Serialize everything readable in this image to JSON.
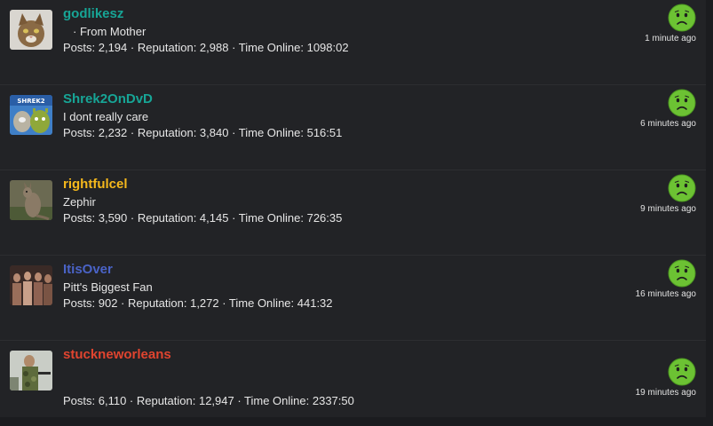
{
  "users": [
    {
      "name": "godlikesz",
      "name_color": "#17a596",
      "status": "· From Mother",
      "stats": "Posts: 2,194 · Reputation: 2,988 · Time Online: 1098:02",
      "time": "1 minute ago",
      "avatar_icon": "cat-avatar",
      "emoji_icon": "worried-face-icon"
    },
    {
      "name": "Shrek2OnDvD",
      "name_color": "#17a596",
      "status": "I dont really care",
      "stats": "Posts: 2,232 · Reputation: 3,840 · Time Online: 516:51",
      "time": "6 minutes ago",
      "avatar_icon": "shrek2-avatar",
      "avatar_text": "SHREK2",
      "emoji_icon": "worried-face-icon"
    },
    {
      "name": "rightfulcel",
      "name_color": "#f5b81c",
      "status": "Zephir",
      "stats": "Posts: 3,590 · Reputation: 4,145 · Time Online: 726:35",
      "time": "9 minutes ago",
      "avatar_icon": "wallaby-avatar",
      "emoji_icon": "worried-face-icon"
    },
    {
      "name": "ItisOver",
      "name_color": "#4a63c7",
      "status": "Pitt's Biggest Fan",
      "stats": "Posts: 902 · Reputation: 1,272 · Time Online: 441:32",
      "time": "16 minutes ago",
      "avatar_icon": "group-photo-avatar",
      "emoji_icon": "worried-face-icon"
    },
    {
      "name": "stuckneworleans",
      "name_color": "#e0442f",
      "status": "",
      "stats": "Posts: 6,110 · Reputation: 12,947 · Time Online: 2337:50",
      "time": "19 minutes ago",
      "avatar_icon": "soldier-avatar",
      "emoji_icon": "worried-face-icon"
    }
  ],
  "colors": {
    "background": "#222326",
    "emoji_green": "#6cc233"
  }
}
